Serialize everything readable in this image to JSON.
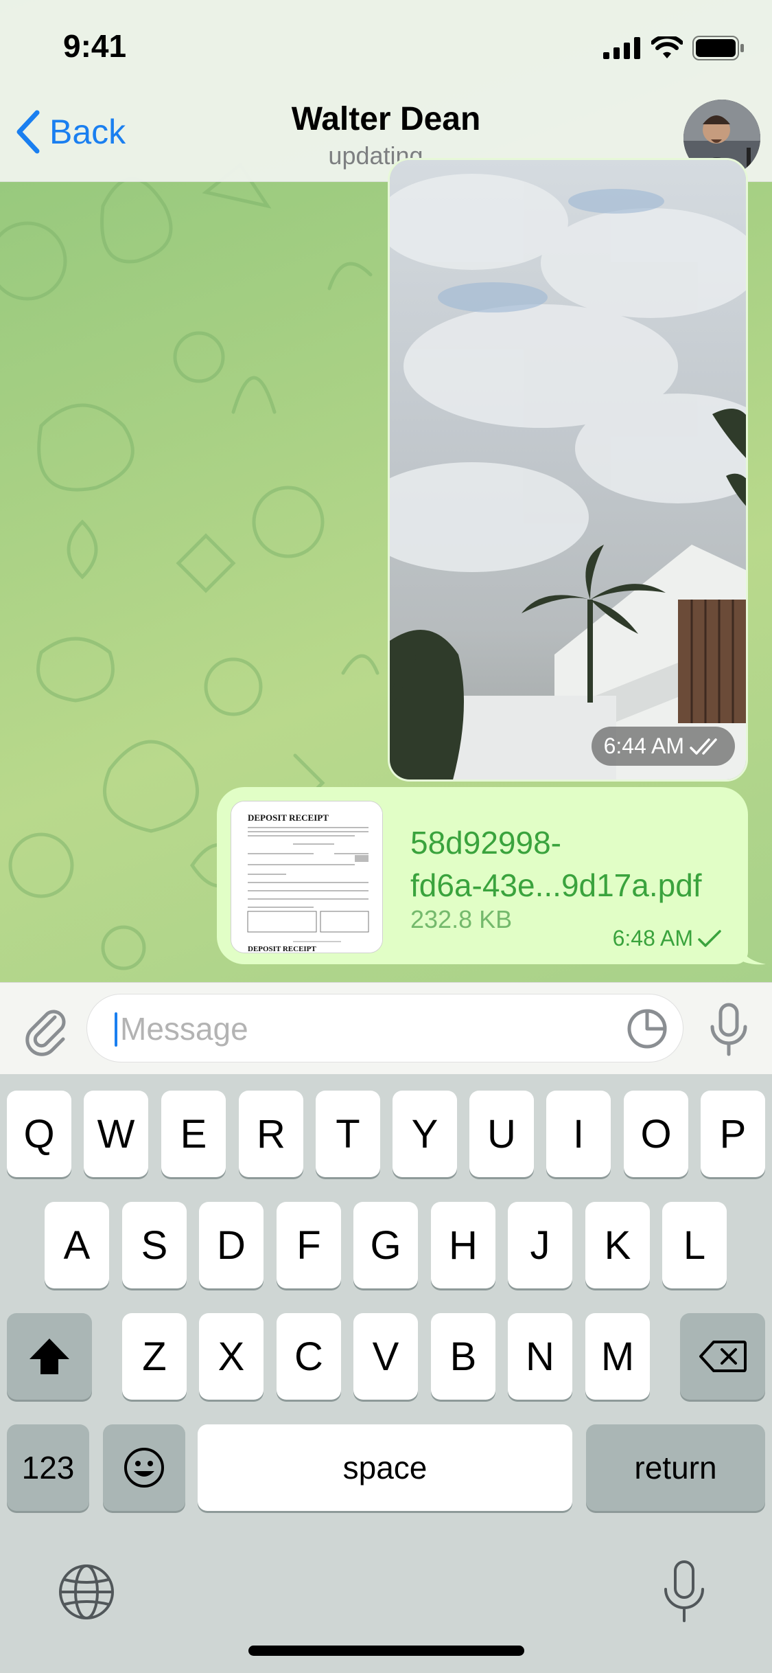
{
  "status_bar": {
    "time": "9:41"
  },
  "header": {
    "back_label": "Back",
    "title": "Walter Dean",
    "subtitle": "updating..."
  },
  "messages": {
    "media": {
      "time": "6:44 AM",
      "status": "read"
    },
    "file": {
      "name_line1": "58d92998-",
      "name_line2": "fd6a-43e...9d17a.pdf",
      "size": "232.8 KB",
      "time": "6:48 AM",
      "status": "sent",
      "thumb_title": "DEPOSIT RECEIPT",
      "thumb_footer": "DEPOSIT RECEIPT"
    }
  },
  "composer": {
    "placeholder": "Message"
  },
  "keyboard": {
    "row1": [
      "Q",
      "W",
      "E",
      "R",
      "T",
      "Y",
      "U",
      "I",
      "O",
      "P"
    ],
    "row2": [
      "A",
      "S",
      "D",
      "F",
      "G",
      "H",
      "J",
      "K",
      "L"
    ],
    "row3": [
      "Z",
      "X",
      "C",
      "V",
      "B",
      "N",
      "M"
    ],
    "numbers_label": "123",
    "space_label": "space",
    "return_label": "return"
  },
  "colors": {
    "accent": "#1a7ff0",
    "outgoing_bubble": "#e1fec6",
    "outgoing_text": "#3aa33d"
  }
}
